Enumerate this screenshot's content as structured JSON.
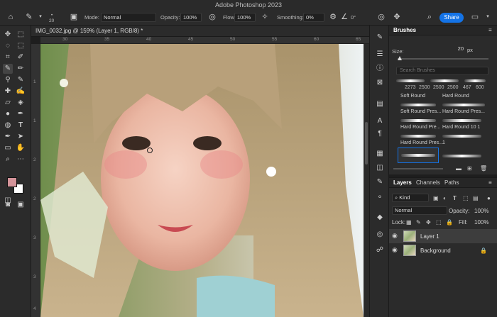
{
  "app": {
    "title": "Adobe Photoshop 2023"
  },
  "options": {
    "brush_size": "20",
    "mode_label": "Mode:",
    "mode_value": "Normal",
    "opacity_label": "Opacity:",
    "opacity_value": "100%",
    "flow_label": "Flow:",
    "flow_value": "100%",
    "smoothing_label": "Smoothing:",
    "smoothing_value": "0%",
    "angle_value": "0°",
    "share_label": "Share"
  },
  "document": {
    "tab_title": "IMG_0032.jpg @ 159% (Layer 1, RGB/8) *",
    "ruler_top": [
      "30",
      "35",
      "40",
      "45",
      "50",
      "55",
      "60",
      "65"
    ],
    "ruler_left": [
      "1",
      "1",
      "2",
      "2",
      "3",
      "3",
      "4"
    ]
  },
  "brushes": {
    "tab_label": "Brushes",
    "size_label": "Size:",
    "size_value": "20",
    "size_unit": "px",
    "search_placeholder": "Search Brushes",
    "sizes": [
      "2273",
      "2500",
      "2500",
      "2500",
      "467",
      "600"
    ],
    "presets": [
      "Soft Round",
      "Hard Round",
      "Soft Round Pres...",
      "Hard Round Pres...",
      "Hard Round Pre...",
      "Hard Round 10 1",
      "Hard Round Pres...",
      "1"
    ]
  },
  "layers": {
    "tabs": [
      "Layers",
      "Channels",
      "Paths"
    ],
    "kind_label": "Kind",
    "blend_mode": "Normal",
    "opacity_label": "Opacity:",
    "opacity_value": "100%",
    "lock_label": "Lock:",
    "fill_label": "Fill:",
    "fill_value": "100%",
    "items": [
      {
        "name": "Layer 1",
        "selected": true
      },
      {
        "name": "Background",
        "selected": false,
        "locked": true
      }
    ]
  },
  "colors": {
    "accent": "#1473e6",
    "foreground": "#d4949a",
    "background": "#ffffff"
  }
}
